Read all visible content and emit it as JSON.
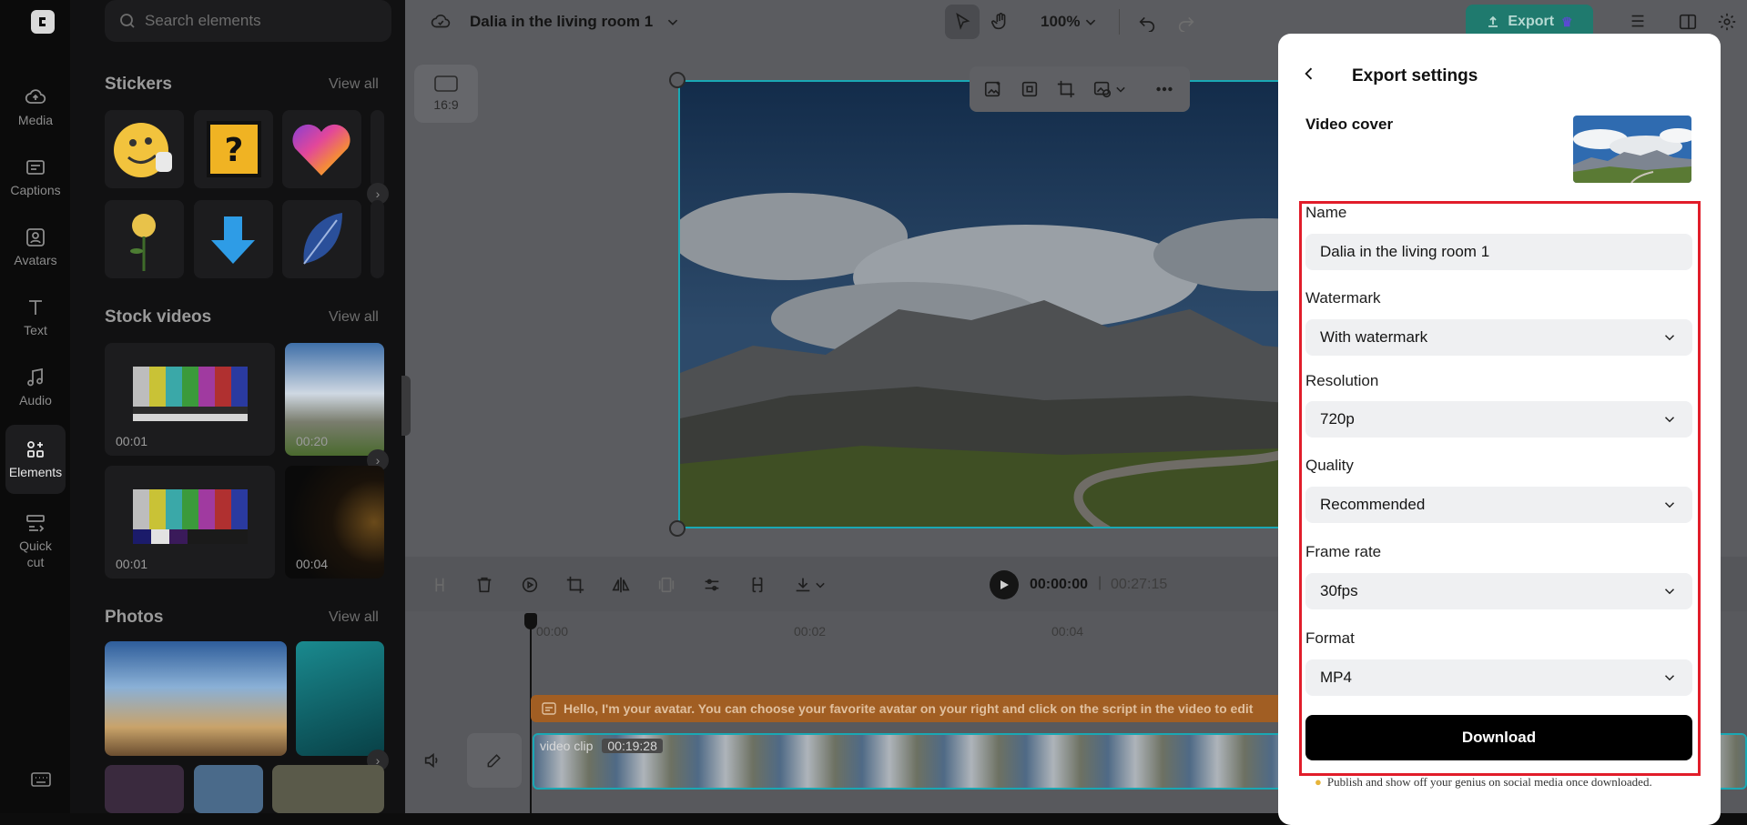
{
  "rail": {
    "items": [
      {
        "label": "Media"
      },
      {
        "label": "Captions"
      },
      {
        "label": "Avatars"
      },
      {
        "label": "Text"
      },
      {
        "label": "Audio"
      },
      {
        "label": "Elements"
      },
      {
        "label": "Quick cut"
      }
    ]
  },
  "panel": {
    "search_placeholder": "Search elements",
    "stickers_title": "Stickers",
    "stock_videos_title": "Stock videos",
    "photos_title": "Photos",
    "view_all": "View all",
    "video_durations": [
      "00:01",
      "00:20",
      "00:01",
      "00:04"
    ]
  },
  "topbar": {
    "project_title": "Dalia in the living room 1",
    "zoom": "100%",
    "export_label": "Export"
  },
  "canvas": {
    "aspect_label": "16:9"
  },
  "timeline": {
    "current_time": "00:00:00",
    "total_time": "00:27:15",
    "ticks": [
      "00:00",
      "00:02",
      "00:04"
    ],
    "avatar_script": "Hello, I'm your avatar. You can choose your favorite avatar on your right and click on the script in the video to edit",
    "clip_label": "video clip",
    "clip_duration": "00:19:28"
  },
  "export": {
    "title": "Export settings",
    "video_cover_label": "Video cover",
    "name_label": "Name",
    "name_value": "Dalia in the living room 1",
    "watermark_label": "Watermark",
    "watermark_value": "With watermark",
    "resolution_label": "Resolution",
    "resolution_value": "720p",
    "quality_label": "Quality",
    "quality_value": "Recommended",
    "frame_rate_label": "Frame rate",
    "frame_rate_value": "30fps",
    "format_label": "Format",
    "format_value": "MP4",
    "download_label": "Download",
    "footer_note": "Publish and show off your genius on social media once downloaded."
  },
  "colors": {
    "highlight": "#e11d2a",
    "export_accent": "#1fa38f",
    "avatar_track": "#d57a2c",
    "clip_border": "#1aa8b4"
  }
}
